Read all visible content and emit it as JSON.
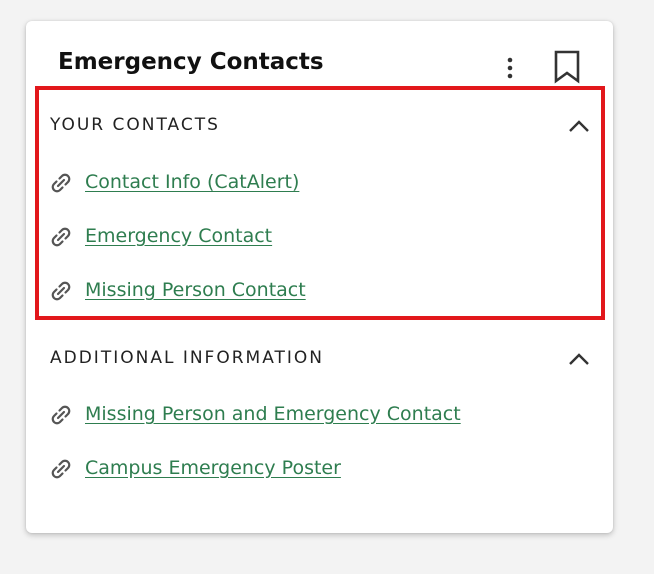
{
  "card": {
    "title": "Emergency Contacts"
  },
  "sections": [
    {
      "title": "YOUR CONTACTS",
      "links": [
        {
          "label": "Contact Info (CatAlert)"
        },
        {
          "label": "Emergency Contact"
        },
        {
          "label": "Missing Person Contact"
        }
      ]
    },
    {
      "title": "ADDITIONAL INFORMATION",
      "links": [
        {
          "label": "Missing Person and Emergency Contact"
        },
        {
          "label": "Campus Emergency Poster"
        }
      ]
    }
  ],
  "colors": {
    "link": "#2e7d4f",
    "highlight": "#e2171b",
    "icon": "#555555"
  },
  "icons": {
    "menu": "more-vertical-icon",
    "bookmark": "bookmark-icon",
    "collapse": "chevron-up-icon",
    "link": "link-icon"
  }
}
